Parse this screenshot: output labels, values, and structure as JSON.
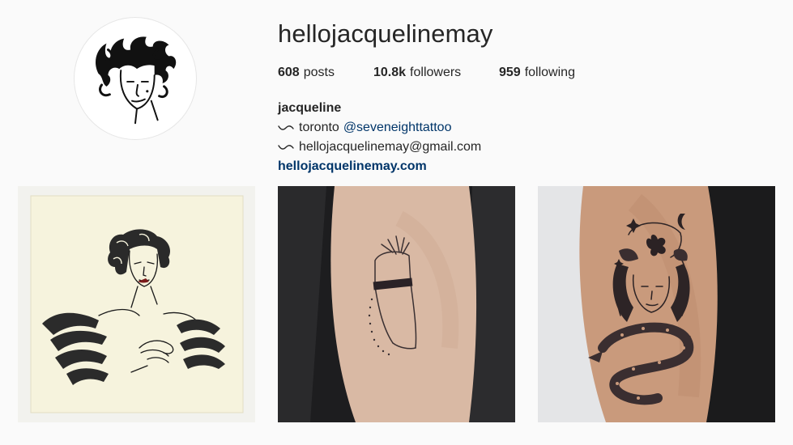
{
  "profile": {
    "username": "hellojacquelinemay",
    "avatar_icon": "woman-portrait-illustration-icon"
  },
  "stats": {
    "posts_count": "608",
    "posts_label": "posts",
    "followers_count": "10.8k",
    "followers_label": "followers",
    "following_count": "959",
    "following_label": "following"
  },
  "bio": {
    "name": "jacqueline",
    "line1_text": "toronto",
    "line1_mention": "@seveneighttattoo",
    "line2_text": "hellojacquelinemay@gmail.com",
    "website": "hellojacquelinemay.com",
    "bullet_icon": "wave-icon"
  },
  "colors": {
    "background": "#fafafa",
    "text": "#262626",
    "link": "#003569"
  },
  "posts": [
    {
      "icon": "flapper-woman-drawing-icon"
    },
    {
      "icon": "arm-tattoo-woman-hat-icon"
    },
    {
      "icon": "arm-tattoo-woman-snake-icon"
    }
  ]
}
